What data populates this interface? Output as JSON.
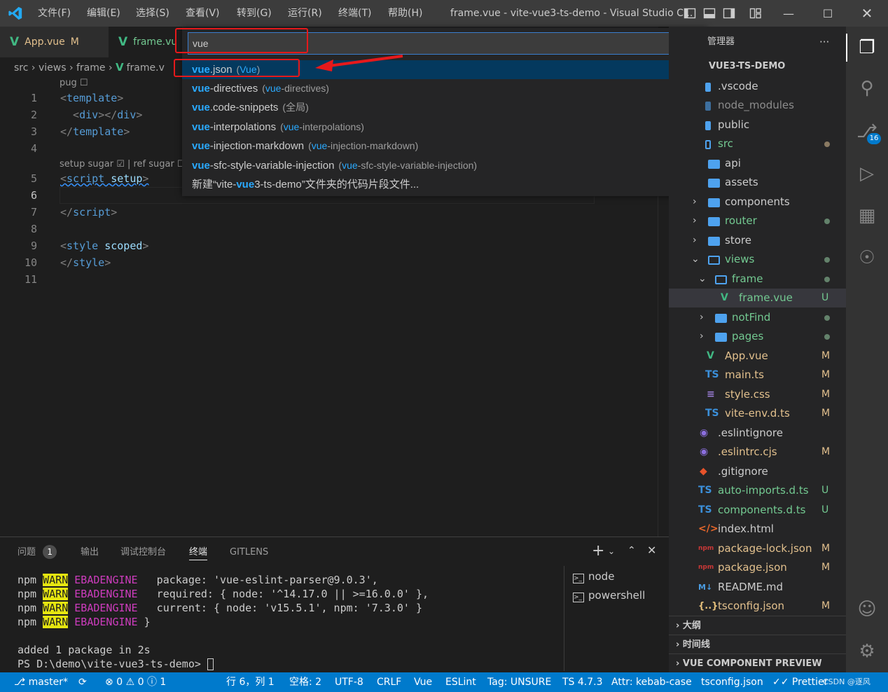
{
  "menu": [
    "文件(F)",
    "编辑(E)",
    "选择(S)",
    "查看(V)",
    "转到(G)",
    "运行(R)",
    "终端(T)",
    "帮助(H)"
  ],
  "window_title": "frame.vue - vite-vue3-ts-demo - Visual Studio C...",
  "tabs": [
    {
      "label": "App.vue",
      "badge": "M"
    },
    {
      "label": "frame.vu"
    }
  ],
  "breadcrumb": {
    "parts": [
      "src",
      "views",
      "frame",
      "frame.v"
    ]
  },
  "editor": {
    "lens_pug": "pug ☐",
    "lens_setup": "setup sugar ☑ | ref sugar ☐",
    "lines": [
      "1",
      "2",
      "3",
      "4",
      "5",
      "6",
      "7",
      "8",
      "9",
      "10",
      "11"
    ]
  },
  "quick_pick": {
    "query": "vue",
    "items": [
      {
        "match": "vue",
        "rest": ".json",
        "sub_match": "Vue",
        "sub_rest": "",
        "sub_open": "(",
        "sub_close": ")"
      },
      {
        "match": "vue",
        "rest": "-directives",
        "sub_match": "vue",
        "sub_rest": "-directives",
        "sub_open": "(",
        "sub_close": ")"
      },
      {
        "match": "vue",
        "rest": ".code-snippets",
        "sub_plain": "(全局)"
      },
      {
        "match": "vue",
        "rest": "-interpolations",
        "sub_match": "vue",
        "sub_rest": "-interpolations",
        "sub_open": "(",
        "sub_close": ")"
      },
      {
        "match": "vue",
        "rest": "-injection-markdown",
        "sub_match": "vue",
        "sub_rest": "-injection-markdown",
        "sub_open": "(",
        "sub_close": ")"
      },
      {
        "match": "vue",
        "rest": "-sfc-style-variable-injection",
        "sub_match": "vue",
        "sub_rest": "-sfc-style-variable-injection",
        "sub_open": "(",
        "sub_close": ")"
      },
      {
        "pre": "新建“vite-",
        "match": "vue",
        "rest": "3-ts-demo”文件夹的代码片段文件..."
      }
    ]
  },
  "explorer": {
    "header": "管理器",
    "more": "···",
    "root": "VUE3-TS-DEMO",
    "items": [
      {
        "name": ".vscode"
      },
      {
        "name": "node_modules"
      },
      {
        "name": "public"
      },
      {
        "name": "src"
      },
      {
        "name": "api"
      },
      {
        "name": "assets"
      },
      {
        "name": "components"
      },
      {
        "name": "router"
      },
      {
        "name": "store"
      },
      {
        "name": "views"
      },
      {
        "name": "frame"
      },
      {
        "name": "frame.vue",
        "status": "U"
      },
      {
        "name": "notFind"
      },
      {
        "name": "pages"
      },
      {
        "name": "App.vue",
        "status": "M"
      },
      {
        "name": "main.ts",
        "status": "M"
      },
      {
        "name": "style.css",
        "status": "M"
      },
      {
        "name": "vite-env.d.ts",
        "status": "M"
      },
      {
        "name": ".eslintignore"
      },
      {
        "name": ".eslintrc.cjs",
        "status": "M"
      },
      {
        "name": ".gitignore"
      },
      {
        "name": "auto-imports.d.ts",
        "status": "U"
      },
      {
        "name": "components.d.ts",
        "status": "U"
      },
      {
        "name": "index.html"
      },
      {
        "name": "package-lock.json",
        "status": "M"
      },
      {
        "name": "package.json",
        "status": "M"
      },
      {
        "name": "README.md"
      },
      {
        "name": "tsconfig.json",
        "status": "M"
      }
    ],
    "sections": [
      "大纲",
      "时间线",
      "VUE COMPONENT PREVIEW"
    ]
  },
  "activity": {
    "scm_badge": "16"
  },
  "panel": {
    "tabs": [
      "问题",
      "输出",
      "调试控制台",
      "终端",
      "GITLENS"
    ],
    "problems_count": "1",
    "terminal_lines": [
      {
        "a": "npm ",
        "w": "WARN",
        "e": " EBADENGINE",
        "t": "   package: 'vue-eslint-parser@9.0.3',"
      },
      {
        "a": "npm ",
        "w": "WARN",
        "e": " EBADENGINE",
        "t": "   required: { node: '^14.17.0 || >=16.0.0' },"
      },
      {
        "a": "npm ",
        "w": "WARN",
        "e": " EBADENGINE",
        "t": "   current: { node: 'v15.5.1', npm: '7.3.0' }"
      },
      {
        "a": "npm ",
        "w": "WARN",
        "e": " EBADENGINE",
        "t": " }"
      }
    ],
    "terminal_tail": [
      "added 1 package in 2s",
      "PS D:\\demo\\vite-vue3-ts-demo> "
    ],
    "terminals": [
      "node",
      "powershell"
    ]
  },
  "status": {
    "branch": "master*",
    "errors": "0",
    "warnings": "0",
    "info": "1",
    "position": "行 6，列 1",
    "spaces": "空格: 2",
    "encoding": "UTF-8",
    "eol": "CRLF",
    "lang": "Vue",
    "eslint": "ESLint",
    "tag": "Tag: UNSURE",
    "ts": "TS 4.7.3",
    "attr": "Attr: kebab-case",
    "tsconfig": "tsconfig.json",
    "prettier": "Prettier",
    "watermark": "CSDN @逐风"
  },
  "colors": {
    "accent": "#007acc",
    "vue": "#41b883",
    "highlight": "#e6191b",
    "match": "#2aaaff"
  }
}
